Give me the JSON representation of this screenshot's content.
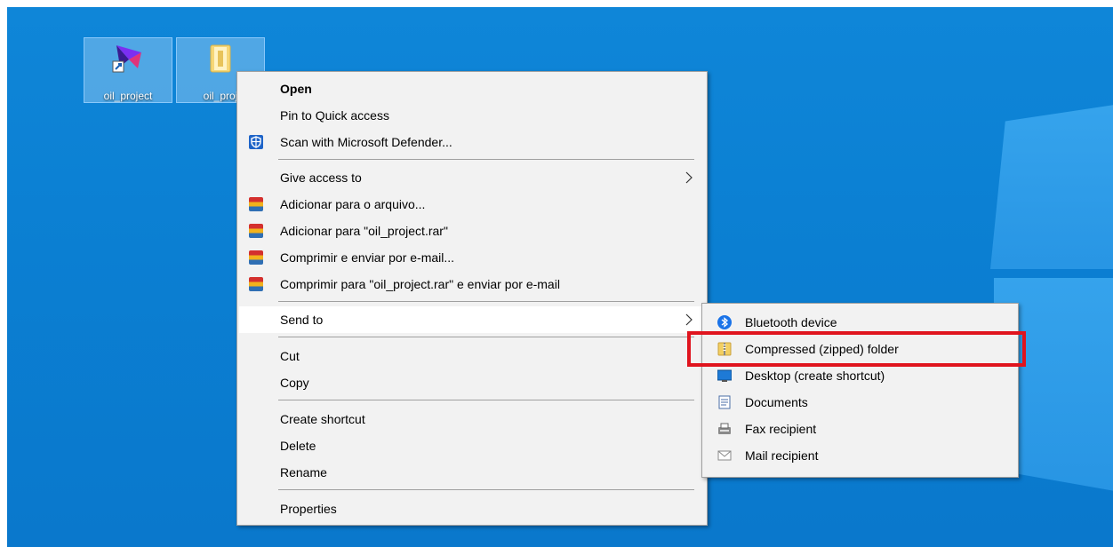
{
  "desktop": {
    "icons": [
      {
        "label": "oil_project"
      },
      {
        "label": "oil_proj"
      }
    ]
  },
  "context_menu": {
    "items": [
      {
        "label": "Open"
      },
      {
        "label": "Pin to Quick access"
      },
      {
        "label": "Scan with Microsoft Defender..."
      },
      {
        "label": "Give access to"
      },
      {
        "label": "Adicionar para o arquivo..."
      },
      {
        "label": "Adicionar para \"oil_project.rar\""
      },
      {
        "label": "Comprimir e enviar por e-mail..."
      },
      {
        "label": "Comprimir para \"oil_project.rar\" e enviar por e-mail"
      },
      {
        "label": "Send to"
      },
      {
        "label": "Cut"
      },
      {
        "label": "Copy"
      },
      {
        "label": "Create shortcut"
      },
      {
        "label": "Delete"
      },
      {
        "label": "Rename"
      },
      {
        "label": "Properties"
      }
    ]
  },
  "send_to_menu": {
    "items": [
      {
        "label": "Bluetooth device"
      },
      {
        "label": "Compressed (zipped) folder"
      },
      {
        "label": "Desktop (create shortcut)"
      },
      {
        "label": "Documents"
      },
      {
        "label": "Fax recipient"
      },
      {
        "label": "Mail recipient"
      }
    ]
  },
  "colors": {
    "desktop": "#0b7fd2",
    "menu_bg": "#f2f2f2",
    "highlight": "#e0141e"
  }
}
